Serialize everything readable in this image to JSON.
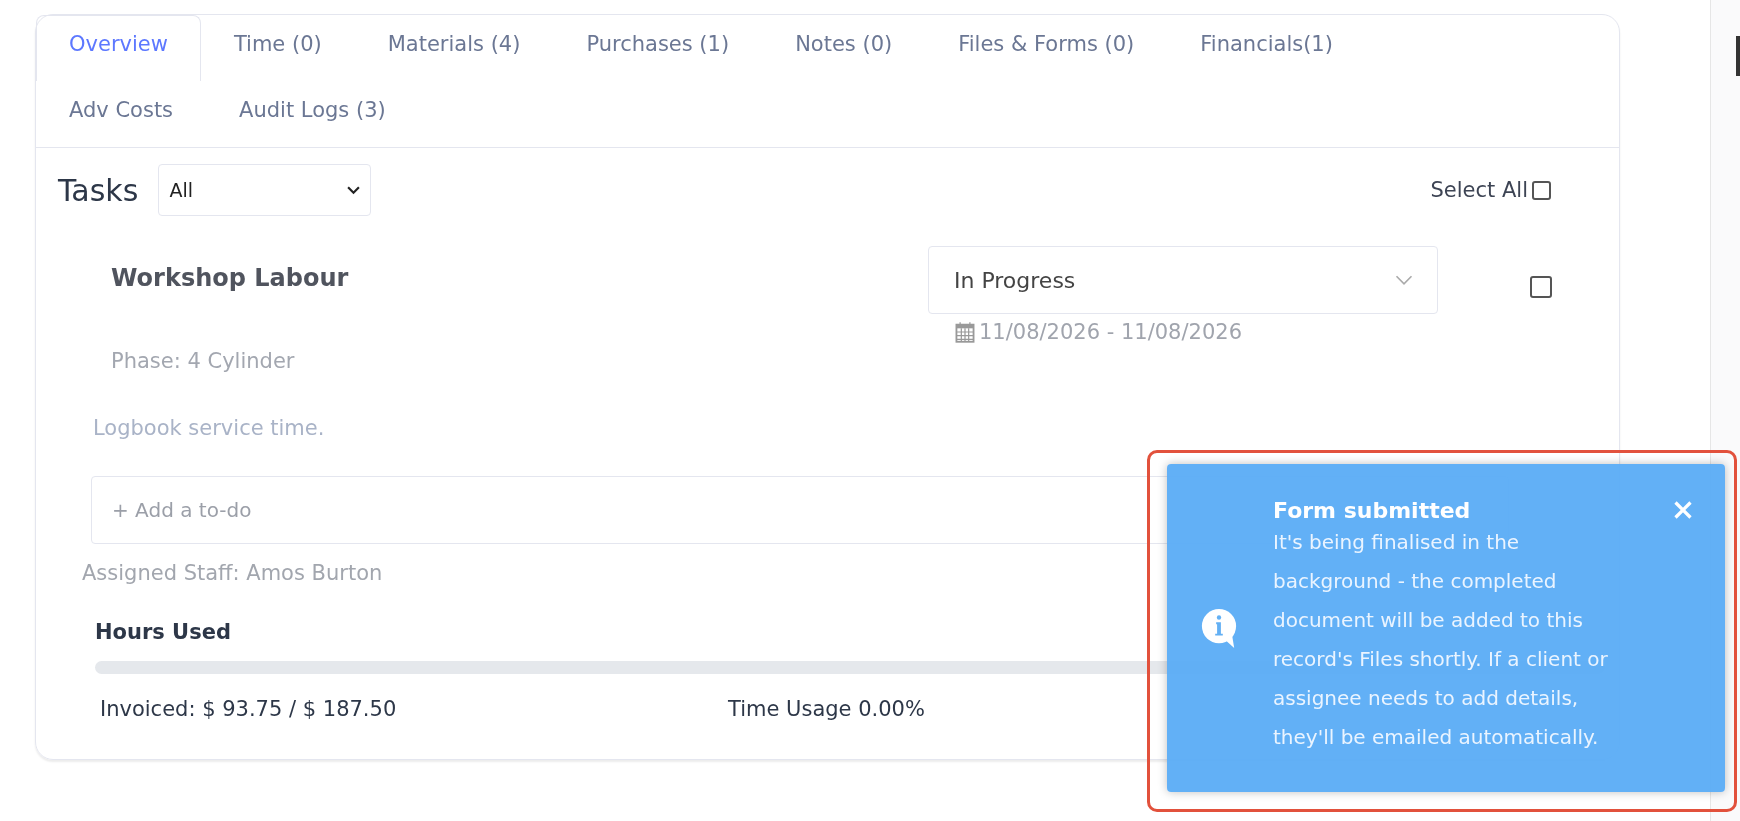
{
  "tabs": [
    {
      "label": "Overview",
      "selected": true
    },
    {
      "label": "Time (0)",
      "selected": false
    },
    {
      "label": "Materials (4)",
      "selected": false
    },
    {
      "label": "Purchases (1)",
      "selected": false
    },
    {
      "label": "Notes (0)",
      "selected": false
    },
    {
      "label": "Files & Forms (0)",
      "selected": false
    },
    {
      "label": "Financials(1)",
      "selected": false
    },
    {
      "label": "Adv Costs",
      "selected": false
    },
    {
      "label": "Audit Logs (3)",
      "selected": false
    }
  ],
  "tasks_header": {
    "title": "Tasks",
    "filter": {
      "value": "All"
    },
    "select_all": {
      "label": "Select All",
      "checked": false
    }
  },
  "task": {
    "title": "Workshop Labour",
    "status": "In Progress",
    "date_range": "11/08/2026 - 11/08/2026",
    "checked": false,
    "phase": "Phase: 4 Cylinder",
    "description": "Logbook service time.",
    "todo": {
      "placeholder": "+ Add a to-do"
    },
    "assigned_staff": {
      "label": "Assigned Staff:",
      "value": "Amos Burton"
    },
    "hours": {
      "label": "Hours Used",
      "level": 0
    },
    "invoiced": "Invoiced: $ 93.75 / $ 187.50",
    "time_usage": "Time Usage 0.00%"
  },
  "toast": {
    "title": "Form submitted",
    "message": "It's being finalised in the background - the completed document will be added to this record's Files shortly. If a client or assignee needs to add details, they'll be emailed automatically.",
    "highlighted": true
  }
}
